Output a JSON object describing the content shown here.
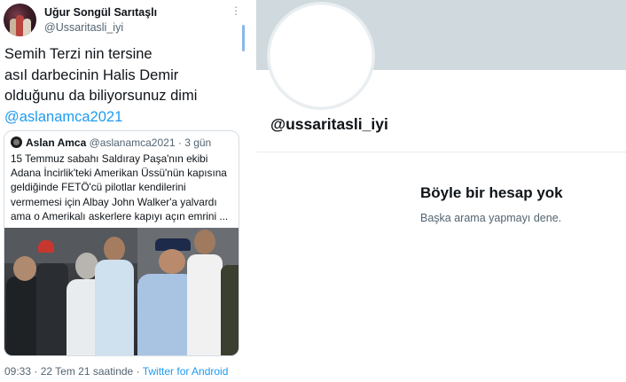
{
  "tweet": {
    "display_name": "Uğur Songül Sarıtaşlı",
    "handle": "@Ussaritasli_iyi",
    "text_lines": [
      "Semih Terzi nin tersine",
      "asıl darbecinin Halis Demir",
      "olduğunu da biliyorsunuz dimi"
    ],
    "mention": "@aslanamca2021",
    "more_icon": "more-vertical-icon",
    "quote": {
      "name": "Aslan Amca",
      "handle": "@aslanamca2021",
      "separator": " · ",
      "time": "3 gün",
      "text_lines": [
        "15 Temmuz sabahı Saldıray Paşa'nın ekibi",
        "Adana İncirlik'teki Amerikan Üssü'nün kapısına",
        "geldiğinde FETÖ'cü pilotlar kendilerini",
        "vermemesi için Albay John Walker'a yalvardı",
        "ama o Amerikalı askerlere kapıyı açın emrini ..."
      ]
    },
    "footer": {
      "time": "09:33",
      "separator": " · ",
      "date": "22 Tem 21 saatinde",
      "separator2": " · ",
      "source": "Twitter for Android"
    }
  },
  "profile": {
    "handle": "@ussaritasli_iyi",
    "not_found_title": "Böyle bir hesap yok",
    "not_found_subtitle": "Başka arama yapmayı dene."
  },
  "colors": {
    "link": "#1d9bf0",
    "banner": "#cfd9de",
    "secondary_text": "#536471"
  }
}
